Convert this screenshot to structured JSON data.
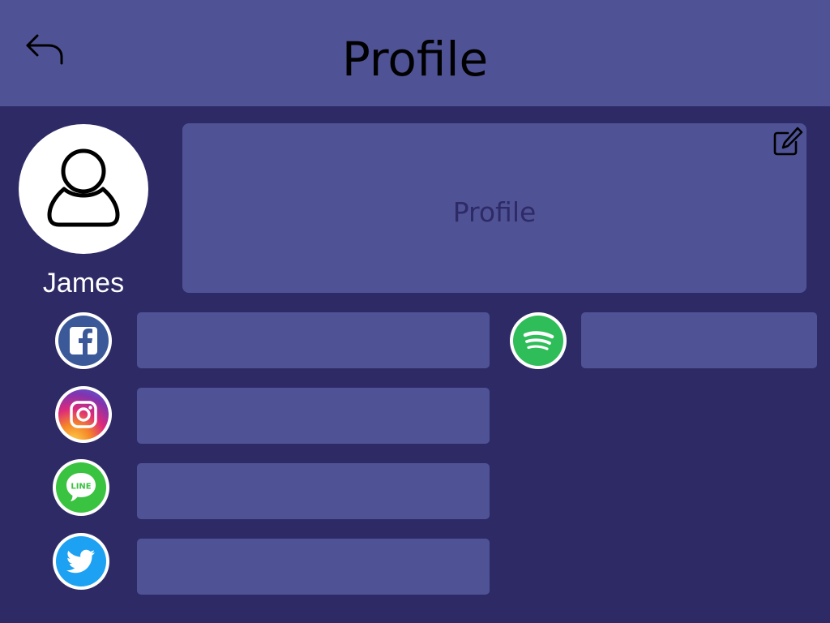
{
  "header": {
    "title": "Profile",
    "back_icon": "back-arrow-icon"
  },
  "user": {
    "name": "James",
    "avatar_icon": "user-icon"
  },
  "profile": {
    "placeholder": "Profile",
    "edit_icon": "edit-icon"
  },
  "socials": [
    {
      "name": "facebook",
      "icon": "facebook-icon",
      "value": ""
    },
    {
      "name": "instagram",
      "icon": "instagram-icon",
      "value": ""
    },
    {
      "name": "line",
      "icon": "line-icon",
      "value": "",
      "icon_text": "LINE"
    },
    {
      "name": "twitter",
      "icon": "twitter-icon",
      "value": ""
    },
    {
      "name": "spotify",
      "icon": "spotify-icon",
      "value": ""
    }
  ],
  "colors": {
    "background": "#2e2a66",
    "panel": "#4f5396",
    "facebook": "#3b5998",
    "line": "#3ac241",
    "twitter": "#1da1f2",
    "spotify": "#2ebd59"
  }
}
